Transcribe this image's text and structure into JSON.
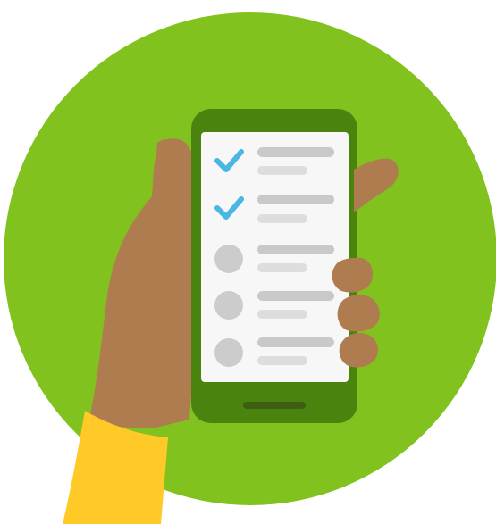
{
  "illustration": {
    "subject": "hand-holding-phone-checklist",
    "colors": {
      "circle": "#82C21F",
      "phone_body": "#4B830F",
      "phone_home_bar": "#3E5E14",
      "screen": "#F7F7F7",
      "skin": "#AE7C4E",
      "skin_shadow": "#9B6B40",
      "sleeve": "#FFC928",
      "check": "#4AB6E4",
      "placeholder_dark": "#C9C9C9",
      "placeholder_light": "#DDDDDD",
      "circle_placeholder": "#CCCCCC"
    },
    "checklist": {
      "items": [
        {
          "status": "checked",
          "icon": "checkmark-icon"
        },
        {
          "status": "checked",
          "icon": "checkmark-icon"
        },
        {
          "status": "unchecked",
          "icon": "circle-icon"
        },
        {
          "status": "unchecked",
          "icon": "circle-icon"
        },
        {
          "status": "unchecked",
          "icon": "circle-icon"
        }
      ]
    }
  }
}
